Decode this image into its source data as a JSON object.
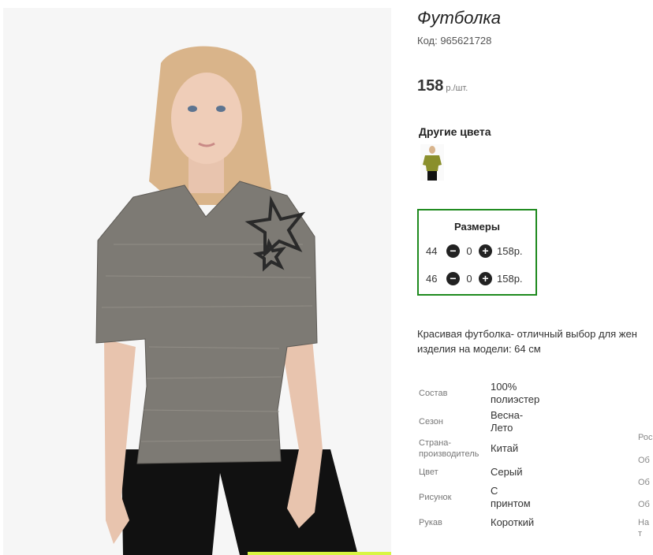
{
  "product": {
    "title": "Футболка",
    "code": "Код: 965621728",
    "price_value": "158",
    "price_unit": "р./шт."
  },
  "other_colors": {
    "title": "Другие цвета",
    "swatch_color": "#8a8f2c"
  },
  "sizes": {
    "title": "Размеры",
    "border_color": "#1e8a1e",
    "rows": [
      {
        "size": "44",
        "qty": "0",
        "price": "158р."
      },
      {
        "size": "46",
        "qty": "0",
        "price": "158р."
      }
    ]
  },
  "description": {
    "line1": "Красивая футболка- отличный выбор для жен",
    "line2": "изделия на модели: 64 см"
  },
  "specs": [
    {
      "label": "Состав",
      "value_l1": "100%",
      "value_l2": "полиэстер"
    },
    {
      "label": "Сезон",
      "value_l1": "Весна-",
      "value_l2": "Лето"
    },
    {
      "label_l1": "Страна-",
      "label_l2": "производитель",
      "value_l1": "Китай"
    },
    {
      "label": "Цвет",
      "value_l1": "Серый"
    },
    {
      "label": "Рисунок",
      "value_l1": "С",
      "value_l2": "принтом"
    },
    {
      "label": "Рукав",
      "value_l1": "Короткий"
    }
  ],
  "specs_extra": [
    "Рос",
    "Об",
    "Об",
    "Об",
    "На",
    "т"
  ],
  "icons": {
    "minus": "minus-circle-icon",
    "plus": "plus-circle-icon"
  }
}
